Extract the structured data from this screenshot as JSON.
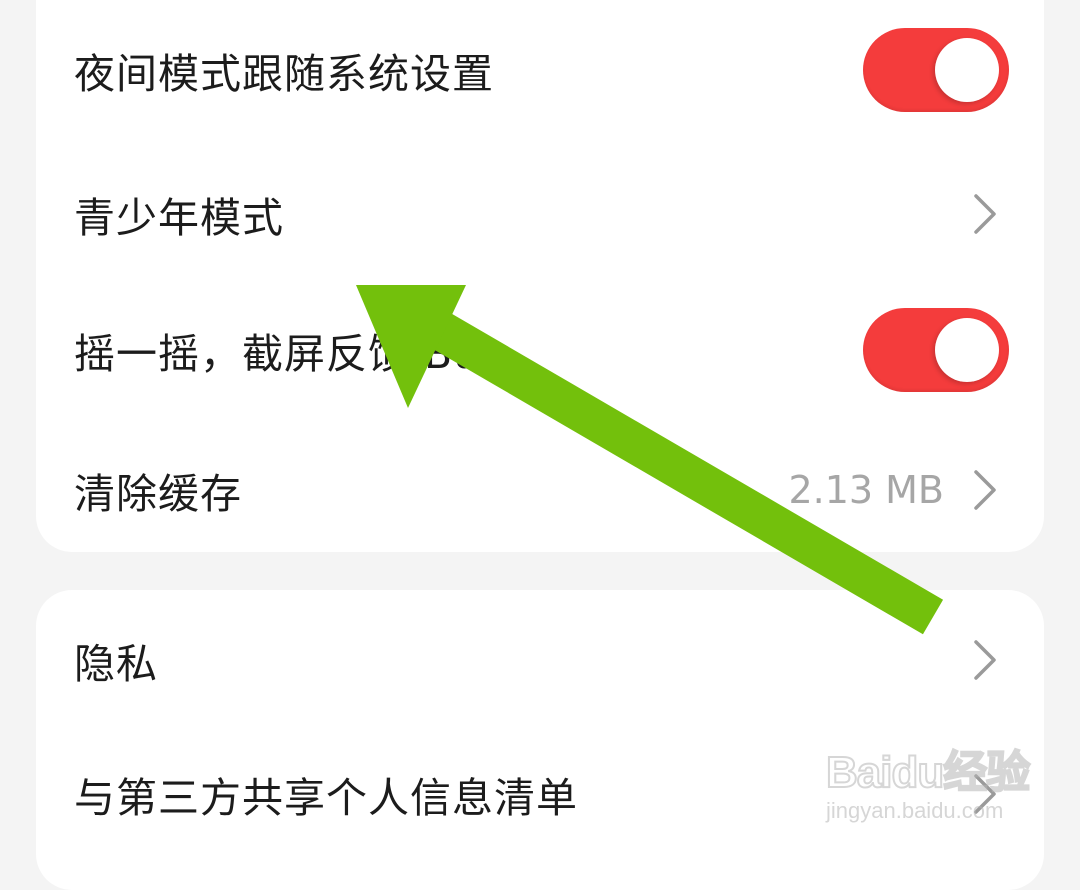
{
  "settings_group_1": {
    "items": [
      {
        "label": "夜间模式跟随系统设置",
        "control": "toggle",
        "on": true
      },
      {
        "label": "青少年模式",
        "control": "chevron"
      },
      {
        "label": "摇一摇，截屏反馈 Bug",
        "control": "toggle",
        "on": true
      },
      {
        "label": "清除缓存",
        "control": "chevron",
        "value": "2.13 MB"
      }
    ]
  },
  "settings_group_2": {
    "items": [
      {
        "label": "隐私",
        "control": "chevron"
      },
      {
        "label": "与第三方共享个人信息清单",
        "control": "chevron"
      }
    ]
  },
  "colors": {
    "toggle_on": "#f43c3c",
    "annotation_arrow": "#73c00c",
    "background": "#f4f4f4",
    "card": "#ffffff"
  },
  "watermark": {
    "brand": "Baidu经验",
    "url": "jingyan.baidu.com"
  }
}
